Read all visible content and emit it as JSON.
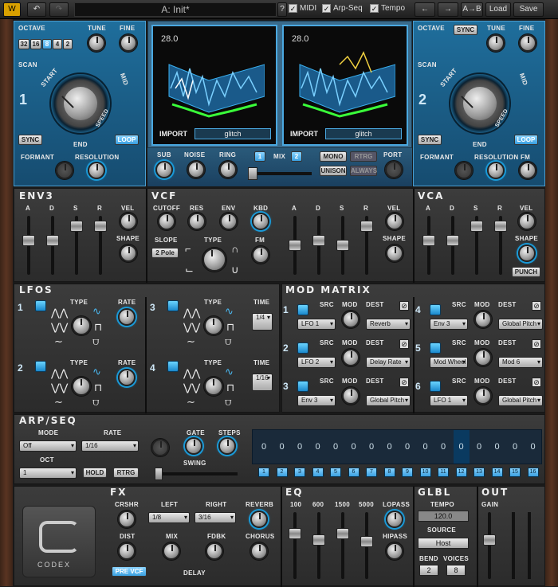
{
  "topbar": {
    "preset": "A: Init*",
    "ab": "A→B",
    "load": "Load",
    "save": "Save",
    "help": "?",
    "midi": "MIDI",
    "arpseq": "Arp-Seq",
    "tempo": "Tempo"
  },
  "osc1": {
    "octave_label": "OCTAVE",
    "octaves": [
      "32",
      "16",
      "8",
      "4",
      "2"
    ],
    "tune": "TUNE",
    "fine": "FINE",
    "scan": "SCAN",
    "start": "START",
    "mid": "MID",
    "end": "END",
    "speed": "SPEED",
    "num": "1",
    "sync": "SYNC",
    "loop": "LOOP",
    "formant": "FORMANT",
    "resolution": "RESOLUTION"
  },
  "osc2": {
    "octave_sync": "SYNC",
    "octave_label": "OCTAVE",
    "tune": "TUNE",
    "fine": "FINE",
    "scan": "SCAN",
    "start": "START",
    "mid": "MID",
    "end": "END",
    "speed": "SPEED",
    "num": "2",
    "sync": "SYNC",
    "loop": "LOOP",
    "formant": "FORMANT",
    "resolution": "RESOLUTION",
    "fm": "FM"
  },
  "wt1": {
    "value": "28.0",
    "import": "IMPORT",
    "name": "glitch"
  },
  "wt2": {
    "value": "28.0",
    "import": "IMPORT",
    "name": "glitch"
  },
  "mixer": {
    "sub": "SUB",
    "noise": "NOISE",
    "ring": "RING",
    "mix": "MIX",
    "m1": "1",
    "m2": "2",
    "mono": "MONO",
    "retro": "RTRG",
    "unison": "UNISON",
    "always": "ALWAYS",
    "port": "PORT"
  },
  "env3": {
    "title": "ENV3",
    "a": "A",
    "d": "D",
    "s": "S",
    "r": "R",
    "vel": "VEL",
    "shape": "SHAPE"
  },
  "vcf": {
    "title": "VCF",
    "cutoff": "CUTOFF",
    "res": "RES",
    "env": "ENV",
    "kbd": "KBD",
    "slope": "SLOPE",
    "slope_val": "2 Pole",
    "type": "TYPE",
    "fm": "FM",
    "a": "A",
    "d": "D",
    "s": "S",
    "r": "R",
    "vel": "VEL",
    "shape": "SHAPE"
  },
  "vca": {
    "title": "VCA",
    "a": "A",
    "d": "D",
    "s": "S",
    "r": "R",
    "vel": "VEL",
    "shape": "SHAPE",
    "punch": "PUNCH"
  },
  "lfos": {
    "title": "LFOS",
    "items": [
      {
        "n": "1",
        "type": "TYPE",
        "rate": "RATE"
      },
      {
        "n": "3",
        "type": "TYPE",
        "rate": "TIME",
        "val": "1/4"
      },
      {
        "n": "2",
        "type": "TYPE",
        "rate": "RATE"
      },
      {
        "n": "4",
        "type": "TYPE",
        "rate": "TIME",
        "val": "1/16"
      }
    ]
  },
  "modmatrix": {
    "title": "MOD MATRIX",
    "src": "SRC",
    "mod": "MOD",
    "dest": "DEST",
    "rows": [
      {
        "n": "1",
        "src": "LFO 1",
        "dest": "Reverb"
      },
      {
        "n": "4",
        "src": "Env 3",
        "dest": "Global Pitch"
      },
      {
        "n": "2",
        "src": "LFO 2",
        "dest": "Delay Rate"
      },
      {
        "n": "5",
        "src": "Mod Wheel",
        "dest": "Mod 6"
      },
      {
        "n": "3",
        "src": "Env 3",
        "dest": "Global Pitch"
      },
      {
        "n": "6",
        "src": "LFO 1",
        "dest": "Global Pitch"
      }
    ]
  },
  "arp": {
    "title": "ARP/SEQ",
    "mode": "MODE",
    "mode_val": "Off",
    "rate": "RATE",
    "rate_val": "1/16",
    "oct": "OCT",
    "oct_val": "1",
    "hold": "HOLD",
    "rtrg": "RTRG",
    "gate": "GATE",
    "steps": "STEPS",
    "swing": "SWING",
    "values": [
      "0",
      "0",
      "0",
      "0",
      "0",
      "0",
      "0",
      "0",
      "0",
      "0",
      "0",
      "0",
      "0",
      "0",
      "0",
      "0"
    ],
    "steps_nums": [
      "1",
      "2",
      "3",
      "4",
      "5",
      "6",
      "7",
      "8",
      "9",
      "10",
      "11",
      "12",
      "13",
      "14",
      "15",
      "16"
    ]
  },
  "fx": {
    "title": "FX",
    "crshr": "CRSHR",
    "left": "LEFT",
    "left_val": "1/8",
    "right": "RIGHT",
    "right_val": "3/16",
    "reverb": "REVERB",
    "dist": "DIST",
    "mix": "MIX",
    "fdbk": "FDBK",
    "chorus": "CHORUS",
    "prevcf": "PRE VCF",
    "delay": "DELAY"
  },
  "eq": {
    "title": "EQ",
    "b100": "100",
    "b600": "600",
    "b1500": "1500",
    "b5000": "5000",
    "lopass": "LOPASS",
    "hipass": "HIPASS"
  },
  "glbl": {
    "title": "GLBL",
    "tempo": "TEMPO",
    "tempo_val": "120.0",
    "source": "SOURCE",
    "source_val": "Host",
    "bend": "BEND",
    "voices": "VOICES",
    "bend_val": "2",
    "voices_val": "8"
  },
  "out": {
    "title": "OUT",
    "gain": "GAIN"
  },
  "logo": "CODEX"
}
